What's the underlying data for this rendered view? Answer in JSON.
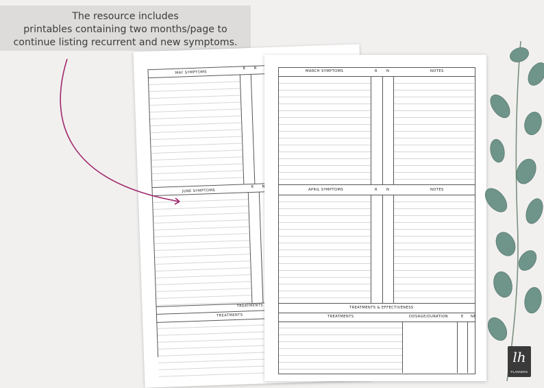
{
  "caption": {
    "line1": "The resource includes",
    "line2": "printables containing two months/page to",
    "line3": "continue listing recurrent and new symptoms."
  },
  "back_sheet": {
    "top_section": "MAY SYMPTOMS",
    "bottom_section": "JUNE SYMPTOMS",
    "col_r": "R",
    "col_n": "N",
    "treatments_header": "TREATMENTS & E",
    "treatments_col": "TREATMENTS"
  },
  "front_sheet": {
    "top_section": "MARCH SYMPTOMS",
    "bottom_section": "APRIL SYMPTOMS",
    "col_r": "R",
    "col_n": "N",
    "notes": "NOTES",
    "treatments_header": "TREATMENTS & EFFECTIVENESS",
    "treatments_col": "TREATMENTS",
    "dosage_col": "DOSAGE/DURATION",
    "col_e": "E",
    "col_ne": "NE"
  },
  "logo": {
    "mark": "lh",
    "text": "PLANNERS"
  },
  "colors": {
    "arrow": "#a0266b",
    "background": "#f1f0ef",
    "leaf": "#6f9489"
  }
}
